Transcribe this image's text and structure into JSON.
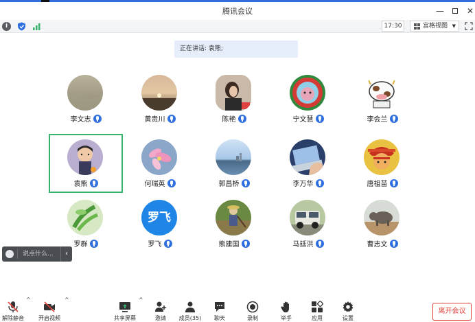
{
  "window": {
    "title": "腾讯会议"
  },
  "infobar": {
    "clock": "17:30",
    "view_mode": "宫格视图"
  },
  "speaking": {
    "label": "正在讲话: 袁熊;"
  },
  "participants": [
    {
      "name": "李文志",
      "avatar": "sand-photo"
    },
    {
      "name": "黄贵川",
      "avatar": "sunset-lake-photo"
    },
    {
      "name": "陈艳",
      "avatar": "girl-portrait-photo"
    },
    {
      "name": "宁文慧",
      "avatar": "cartoon-wreath"
    },
    {
      "name": "李会兰",
      "avatar": "cartoon-cow"
    },
    {
      "name": "袁熊",
      "avatar": "child-photo",
      "speaking": true
    },
    {
      "name": "何瑞英",
      "avatar": "pink-flower-photo"
    },
    {
      "name": "郭昌桥",
      "avatar": "city-lake-photo"
    },
    {
      "name": "李万华",
      "avatar": "laptop-photo"
    },
    {
      "name": "唐祖苗",
      "avatar": "opera-mask-photo"
    },
    {
      "name": "罗群",
      "avatar": "green-leaves-photo"
    },
    {
      "name": "罗飞",
      "avatar": "text-avatar",
      "avatar_text": "罗飞"
    },
    {
      "name": "熊建国",
      "avatar": "field-worker-photo"
    },
    {
      "name": "马廷洪",
      "avatar": "jeep-photo"
    },
    {
      "name": "曹志文",
      "avatar": "elephant-photo"
    }
  ],
  "chat": {
    "placeholder": "说点什么..."
  },
  "toolbar": {
    "unmute": "解除静音",
    "start_video": "开启视频",
    "share_screen": "共享屏幕",
    "invite": "邀请",
    "members": "成员(35)",
    "chat": "聊天",
    "record": "录制",
    "raise_hand": "举手",
    "apps": "应用",
    "settings": "设置",
    "leave": "离开会议"
  },
  "colors": {
    "accent": "#2f6fde",
    "speaking_border": "#35b26b",
    "leave_red": "#e0413a"
  }
}
